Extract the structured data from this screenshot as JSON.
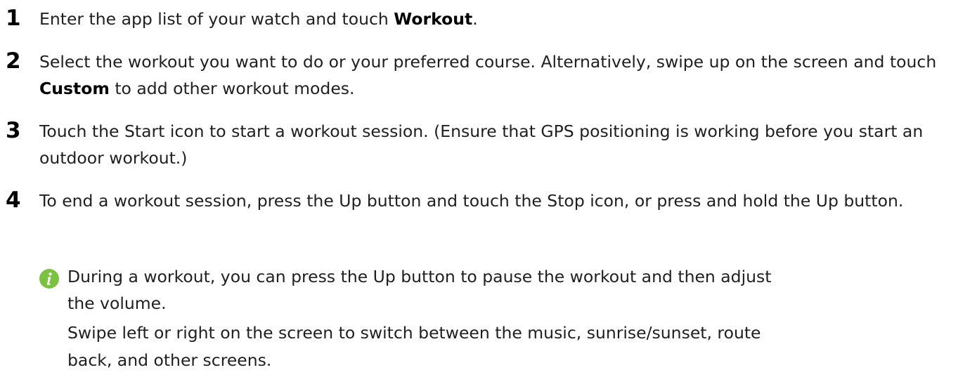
{
  "steps": [
    {
      "number": "1",
      "pre": "Enter the app list of your watch and touch ",
      "bold": "Workout",
      "post": "."
    },
    {
      "number": "2",
      "pre": "Select the workout you want to do or your preferred course. Alternatively, swipe up on the screen and touch ",
      "bold": "Custom",
      "post": " to add other workout modes."
    },
    {
      "number": "3",
      "text": "Touch the Start icon to start a workout session. (Ensure that GPS positioning is working before you start an outdoor workout.)"
    },
    {
      "number": "4",
      "text": "To end a workout session, press the Up button and touch the Stop icon, or press and hold the Up button."
    }
  ],
  "note": {
    "icon": "info-icon",
    "icon_color": "#7cc242",
    "lines": [
      "During a workout, you can press the Up button to pause the workout and then adjust",
      "the volume.",
      "Swipe left or right on the screen to switch between the music, sunrise/sunset, route",
      "back, and other screens."
    ]
  }
}
